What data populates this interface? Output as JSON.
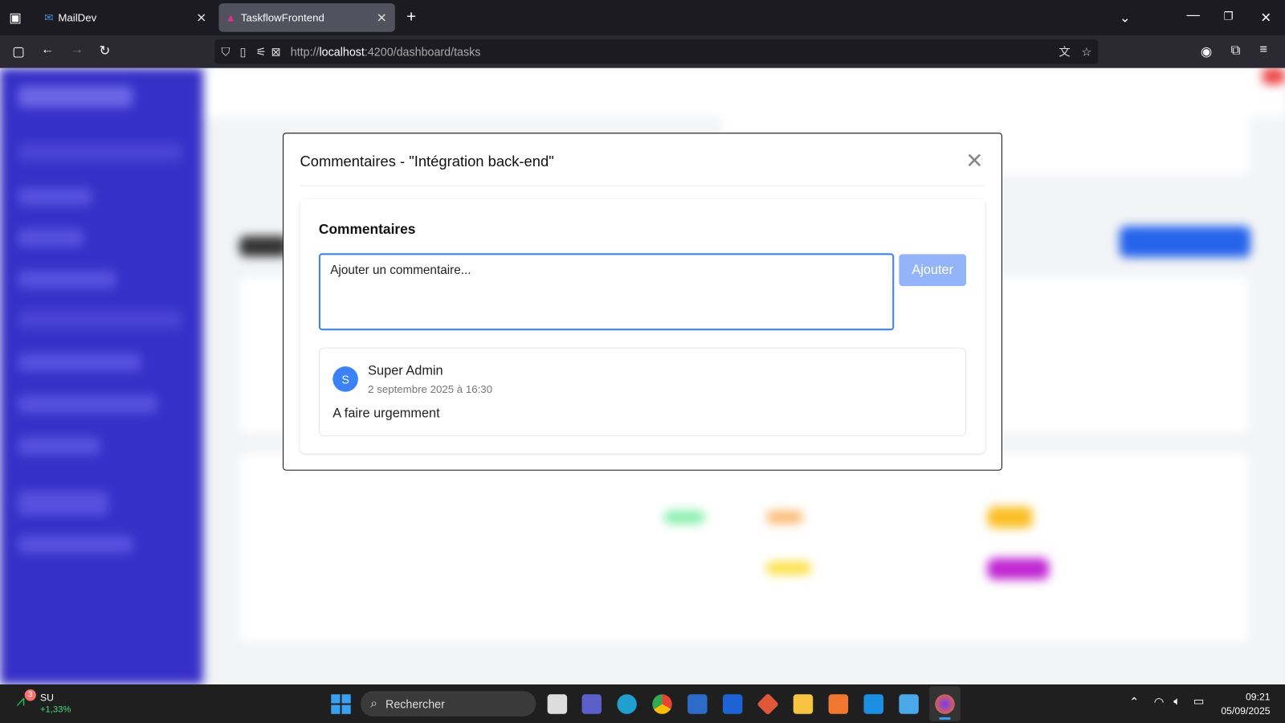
{
  "browser": {
    "tabs": [
      {
        "label": "MailDev",
        "active": false
      },
      {
        "label": "TaskflowFrontend",
        "active": true
      }
    ],
    "url_prefix": "http://",
    "url_host": "localhost",
    "url_rest": ":4200/dashboard/tasks"
  },
  "modal": {
    "title": "Commentaires - \"Intégration back-end\"",
    "section_title": "Commentaires",
    "input_placeholder": "Ajouter un commentaire...",
    "add_button": "Ajouter",
    "comments": [
      {
        "initial": "S",
        "author": "Super Admin",
        "date": "2 septembre 2025 à 16:30",
        "text": "A faire urgemment"
      }
    ]
  },
  "taskbar": {
    "stock_badge": "3",
    "stock_name": "SU",
    "stock_change": "+1,33%",
    "search_placeholder": "Rechercher",
    "time": "09:21",
    "date": "05/09/2025"
  },
  "colors": {
    "accent": "#3b82f6",
    "sidebar": "#3730c8",
    "button_disabled": "#93b4f8"
  }
}
